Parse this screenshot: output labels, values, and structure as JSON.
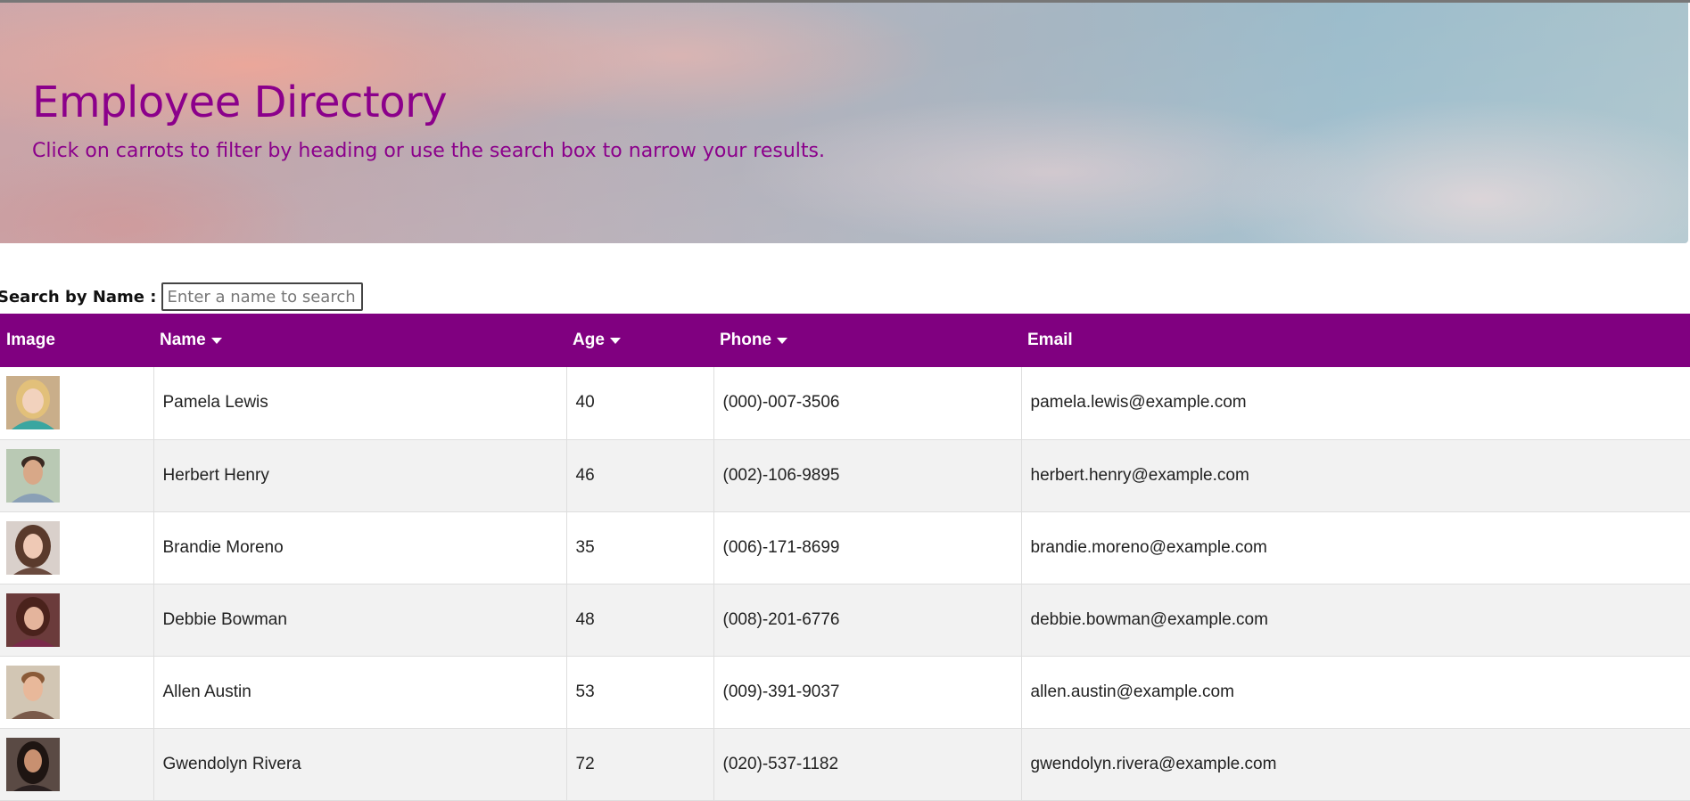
{
  "header": {
    "title": "Employee Directory",
    "subtitle": "Click on carrots to filter by heading or use the search box to narrow your results."
  },
  "search": {
    "label": "Search by Name :",
    "placeholder": "Enter a name to search",
    "value": ""
  },
  "table": {
    "columns": {
      "image": "Image",
      "name": "Name",
      "age": "Age",
      "phone": "Phone",
      "email": "Email"
    },
    "rows": [
      {
        "name": "Pamela Lewis",
        "age": "40",
        "phone": "(000)-007-3506",
        "email": "pamela.lewis@example.com"
      },
      {
        "name": "Herbert Henry",
        "age": "46",
        "phone": "(002)-106-9895",
        "email": "herbert.henry@example.com"
      },
      {
        "name": "Brandie Moreno",
        "age": "35",
        "phone": "(006)-171-8699",
        "email": "brandie.moreno@example.com"
      },
      {
        "name": "Debbie Bowman",
        "age": "48",
        "phone": "(008)-201-6776",
        "email": "debbie.bowman@example.com"
      },
      {
        "name": "Allen Austin",
        "age": "53",
        "phone": "(009)-391-9037",
        "email": "allen.austin@example.com"
      },
      {
        "name": "Gwendolyn Rivera",
        "age": "72",
        "phone": "(020)-537-1182",
        "email": "gwendolyn.rivera@example.com"
      }
    ]
  },
  "colors": {
    "accent": "#800080",
    "title": "#8b008b"
  }
}
